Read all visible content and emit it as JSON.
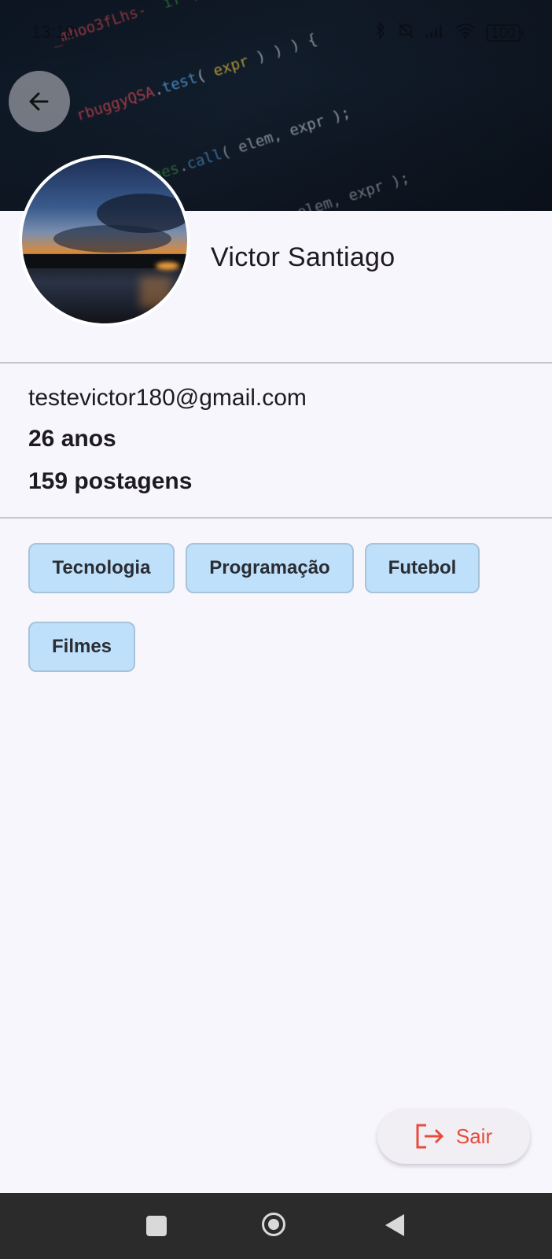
{
  "status_bar": {
    "time": "13:10",
    "battery": "100",
    "icons": [
      "bluetooth-icon",
      "mute-icon",
      "signal-icon",
      "wifi-icon",
      "battery-icon"
    ]
  },
  "header": {
    "background": "code-screenshot-image",
    "back_icon": "arrow-left-icon"
  },
  "profile": {
    "name": "Victor Santiago",
    "email": "testevictor180@gmail.com",
    "age": "26 anos",
    "posts": "159 postagens"
  },
  "interests": [
    "Tecnologia",
    "Programação",
    "Futebol",
    "Filmes"
  ],
  "logout": {
    "label": "Sair",
    "icon": "logout-icon",
    "color": "#e64b3c"
  },
  "colors": {
    "background": "#f8f6fd",
    "chip_background": "#bfe0fa",
    "chip_border": "#a7c3d9"
  }
}
